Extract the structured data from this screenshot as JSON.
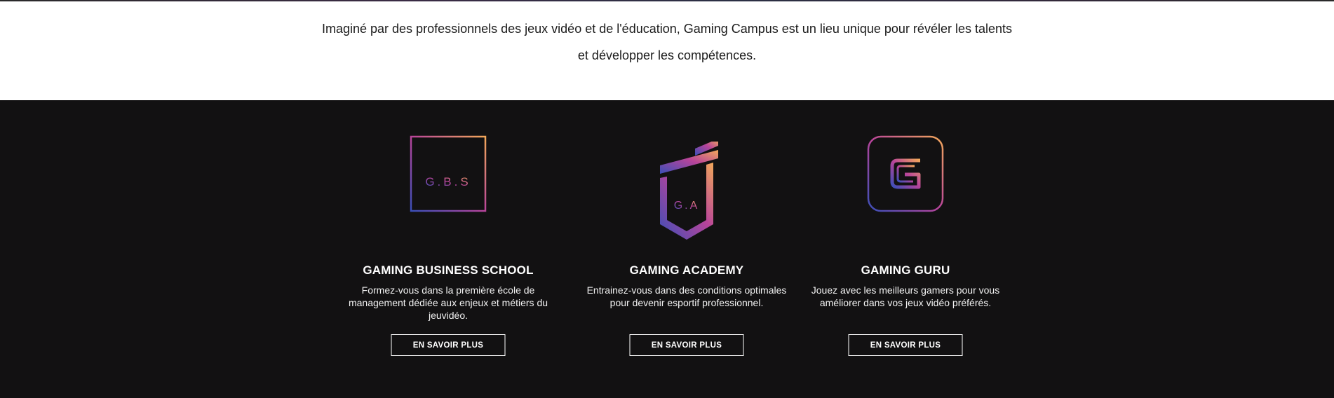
{
  "intro": {
    "text": "Imaginé par des professionnels des jeux vidéo et de l'éducation, Gaming Campus est un lieu unique pour révéler les talents et développer les compétences."
  },
  "cards": [
    {
      "logo_text": "G.B.S",
      "title": "GAMING BUSINESS SCHOOL",
      "description": "Formez-vous dans la première école de management dédiée aux enjeux et métiers du jeuvidéo.",
      "button_label": "EN SAVOIR PLUS"
    },
    {
      "logo_text": "G.A",
      "title": "GAMING ACADEMY",
      "description": "Entrainez-vous dans des conditions optimales pour devenir esportif professionnel.",
      "button_label": "EN SAVOIR PLUS"
    },
    {
      "logo_text": "",
      "title": "GAMING GURU",
      "description": "Jouez avec les meilleurs gamers pour vous améliorer dans vos jeux vidéo préférés.",
      "button_label": "EN SAVOIR PLUS"
    }
  ],
  "colors": {
    "dark_background": "#121112",
    "gradient_start": "#3a4fb8",
    "gradient_mid": "#b8449a",
    "gradient_end": "#f2a85a"
  }
}
